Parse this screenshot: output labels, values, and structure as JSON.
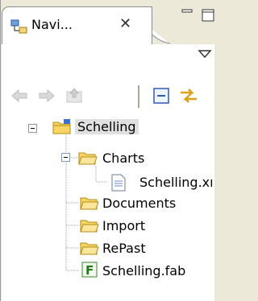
{
  "tab": {
    "label": "Navi...",
    "close": "✕"
  },
  "tree": {
    "root": "Schelling",
    "charts": "Charts",
    "chart_file": "Schelling.xı",
    "documents": "Documents",
    "import": "Import",
    "repast": "RePast",
    "fab": "Schelling.fab"
  }
}
